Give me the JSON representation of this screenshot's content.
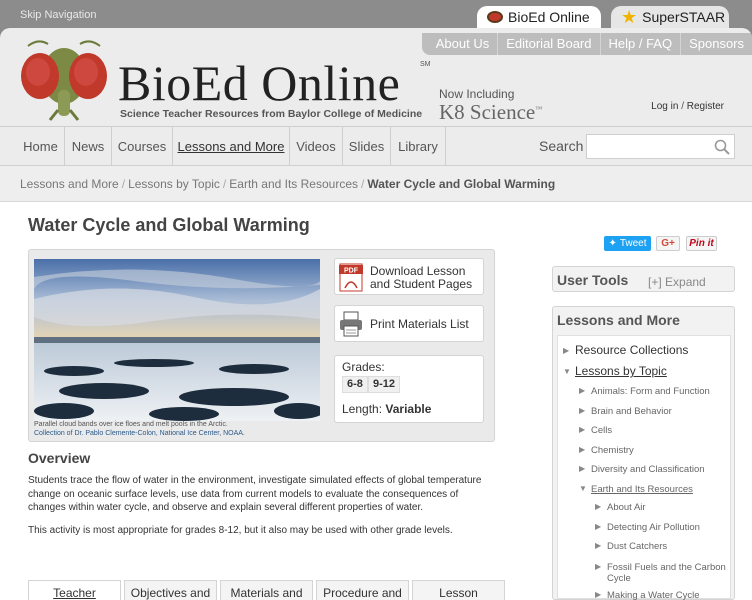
{
  "topbar": {
    "skip_nav": "Skip Navigation",
    "sites": [
      "BioEd Online",
      "SuperSTAAR"
    ]
  },
  "header": {
    "util_links": [
      "About Us",
      "Editorial Board",
      "Help / FAQ",
      "Sponsors"
    ],
    "logo_title": "BioEd Online",
    "logo_sm": "SM",
    "logo_subtitle": "Science Teacher Resources from Baylor College of Medicine",
    "now_including": "Now Including",
    "k8": "K8 Science",
    "login": "Log in",
    "login_sep": "/",
    "register": "Register"
  },
  "nav": {
    "items": [
      "Home",
      "News",
      "Courses",
      "Lessons and More",
      "Videos",
      "Slides",
      "Library"
    ],
    "active": "Lessons and More",
    "search_label": "Search",
    "search_value": ""
  },
  "breadcrumb": {
    "items": [
      "Lessons and More",
      "Lessons by Topic",
      "Earth and Its Resources"
    ],
    "current": "Water Cycle and Global Warming",
    "sep": "/"
  },
  "page": {
    "title": "Water Cycle and Global Warming",
    "share": {
      "tweet": "Tweet",
      "gplus": "G+",
      "pinit": "Pin it"
    },
    "caption": "Parallel cloud bands over ice floes and melt pools in the Arctic.",
    "credit": "Collection of Dr. Pablo Clemente-Colon, National Ice Center, NOAA.",
    "download_label": "Download Lesson and Student Pages",
    "pdf_icon_text": "PDF",
    "print_label": "Print Materials List",
    "grades_label": "Grades:",
    "grades": [
      "6-8",
      "9-12"
    ],
    "length_label": "Length:",
    "length_value": "Variable",
    "overview_heading": "Overview",
    "overview_text": "Students trace the flow of water in the environment, investigate simulated effects of global temperature change on oceanic surface levels, use data from current models to evaluate the consequences of changes within water cycle, and observe and explain several different properties of water.",
    "note_text": "This activity is most appropriate for grades 8-12, but it also may be used with other grade levels.",
    "tabs": [
      "Teacher",
      "Objectives and",
      "Materials and",
      "Procedure and",
      "Lesson"
    ]
  },
  "sidebar": {
    "user_tools": "User Tools",
    "expand": "[+] Expand",
    "lessons_heading": "Lessons and More",
    "items": {
      "resource_collections": "Resource Collections",
      "lessons_by_topic": "Lessons by Topic",
      "animals": "Animals: Form and Function",
      "brain": "Brain and Behavior",
      "cells": "Cells",
      "chemistry": "Chemistry",
      "diversity": "Diversity and Classification",
      "earth": "Earth and Its Resources",
      "about_air": "About Air",
      "detecting": "Detecting Air Pollution",
      "dust": "Dust Catchers",
      "fossil_1": "Fossil Fuels and the Carbon",
      "fossil_2": "Cycle",
      "making": "Making a Water Cycle"
    }
  },
  "colors": {
    "tweet": "#1da1f2",
    "pin": "#bd081c",
    "accent_star": "#f0b400"
  }
}
